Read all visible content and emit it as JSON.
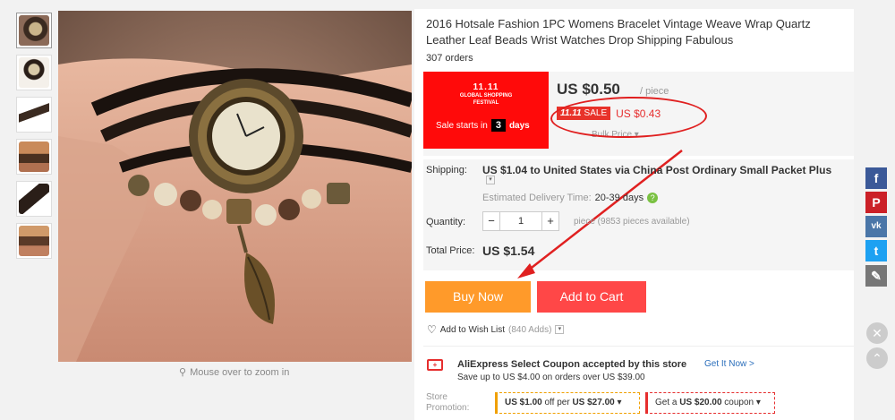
{
  "product": {
    "title": "2016 Hotsale Fashion 1PC Womens Bracelet Vintage Weave Wrap Quartz Leather Leaf Beads Wrist Watches Drop Shipping Fabulous",
    "orders": "307 orders",
    "zoom_hint": "Mouse over to zoom in"
  },
  "festival": {
    "logo_line1": "11.11",
    "logo_line2": "GLOBAL SHOPPING FESTIVAL",
    "sale_starts": "Sale starts in",
    "days_count": "3",
    "days_label": "days"
  },
  "price": {
    "main": "US $0.50",
    "unit": "/ piece",
    "sale_badge_prefix": "11.11",
    "sale_badge_label": "SALE",
    "sale_price": "US $0.43",
    "bulk": "Bulk Price ▾"
  },
  "shipping": {
    "label": "Shipping:",
    "value": "US $1.04 to United States via China Post Ordinary Small Packet Plus",
    "est_label": "Estimated Delivery Time:",
    "est_value": "20-39 days"
  },
  "quantity": {
    "label": "Quantity:",
    "value": "1",
    "minus": "−",
    "plus": "+",
    "note": "piece (9853 pieces available)"
  },
  "total": {
    "label": "Total Price:",
    "value": "US $1.54"
  },
  "actions": {
    "buy_now": "Buy Now",
    "add_to_cart": "Add to Cart",
    "wishlist": "Add to Wish List",
    "wishlist_count": "(840 Adds)"
  },
  "coupon": {
    "title": "AliExpress Select Coupon accepted by this store",
    "link": "Get It Now >",
    "sub": "Save up to US $4.00 on orders over US $39.00"
  },
  "promotion": {
    "label_line1": "Store",
    "label_line2": "Promotion:",
    "promo1_a": "US $1.00",
    "promo1_b": "off per",
    "promo1_c": "US $27.00",
    "promo2_a": "Get a",
    "promo2_b": "US $20.00",
    "promo2_c": "coupon"
  },
  "social": {
    "items": [
      "f",
      "P",
      "vk",
      "t",
      "✎"
    ]
  },
  "colors": {
    "buy_now": "#ff9a2a",
    "add_to_cart": "#ff4747",
    "festival_red": "#ff0a0a",
    "sale_red": "#e62e2e"
  }
}
